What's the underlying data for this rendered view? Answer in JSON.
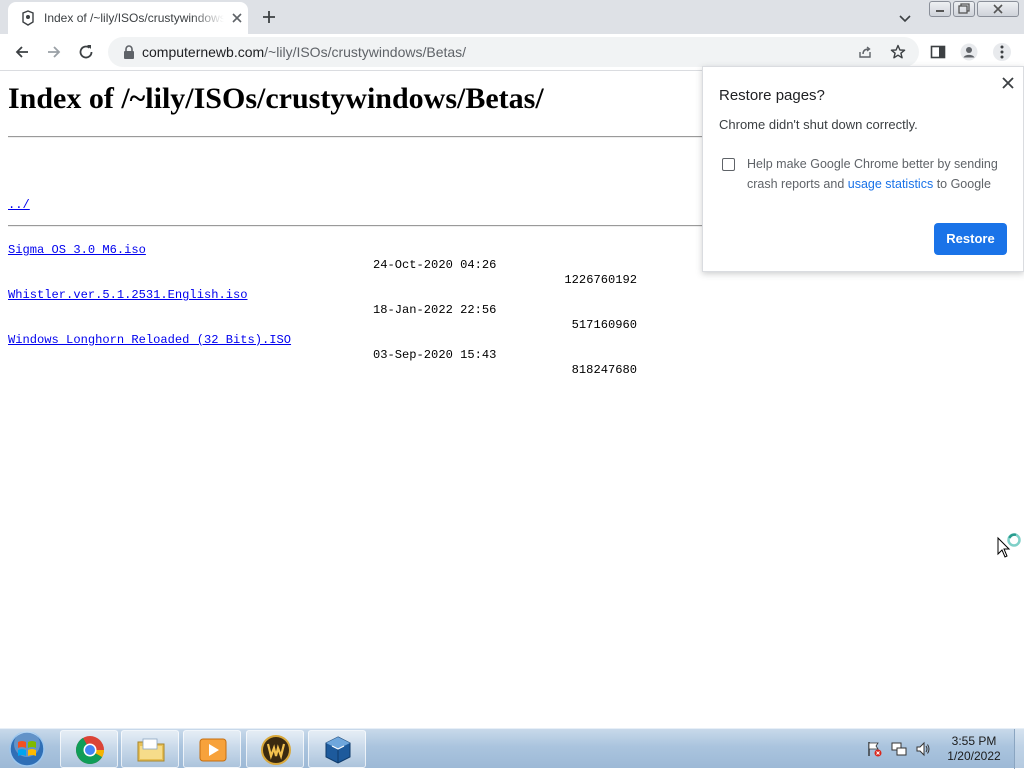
{
  "browser": {
    "tab_title": "Index of /~lily/ISOs/crustywindows/Betas/",
    "url_domain": "computernewb.com",
    "url_path": "/~lily/ISOs/crustywindows/Betas/"
  },
  "page": {
    "heading": "Index of /~lily/ISOs/crustywindows/Betas/",
    "parent_link": "../",
    "entries": [
      {
        "name": "Sigma OS 3.0 M6.iso",
        "date": "24-Oct-2020 04:26",
        "size": "1226760192"
      },
      {
        "name": "Whistler.ver.5.1.2531.English.iso",
        "date": "18-Jan-2022 22:56",
        "size": "517160960"
      },
      {
        "name": "Windows Longhorn Reloaded (32 Bits).ISO",
        "date": "03-Sep-2020 15:43",
        "size": "818247680"
      }
    ]
  },
  "popup": {
    "title": "Restore pages?",
    "message": "Chrome didn't shut down correctly.",
    "checkbox_text_before": "Help make Google Chrome better by sending crash reports and ",
    "checkbox_link": "usage statistics",
    "checkbox_text_after": " to Google",
    "checkbox_checked": false,
    "restore_label": "Restore"
  },
  "taskbar": {
    "items": [
      "chrome-icon",
      "file-explorer-icon",
      "media-player-icon",
      "world-of-warcraft-icon",
      "virtualbox-icon"
    ],
    "time": "3:55 PM",
    "date": "1/20/2022"
  },
  "colors": {
    "accent": "#1a73e8",
    "link": "#0000ee",
    "tabstrip": "#dee1e6",
    "omnibox": "#f1f3f4"
  }
}
